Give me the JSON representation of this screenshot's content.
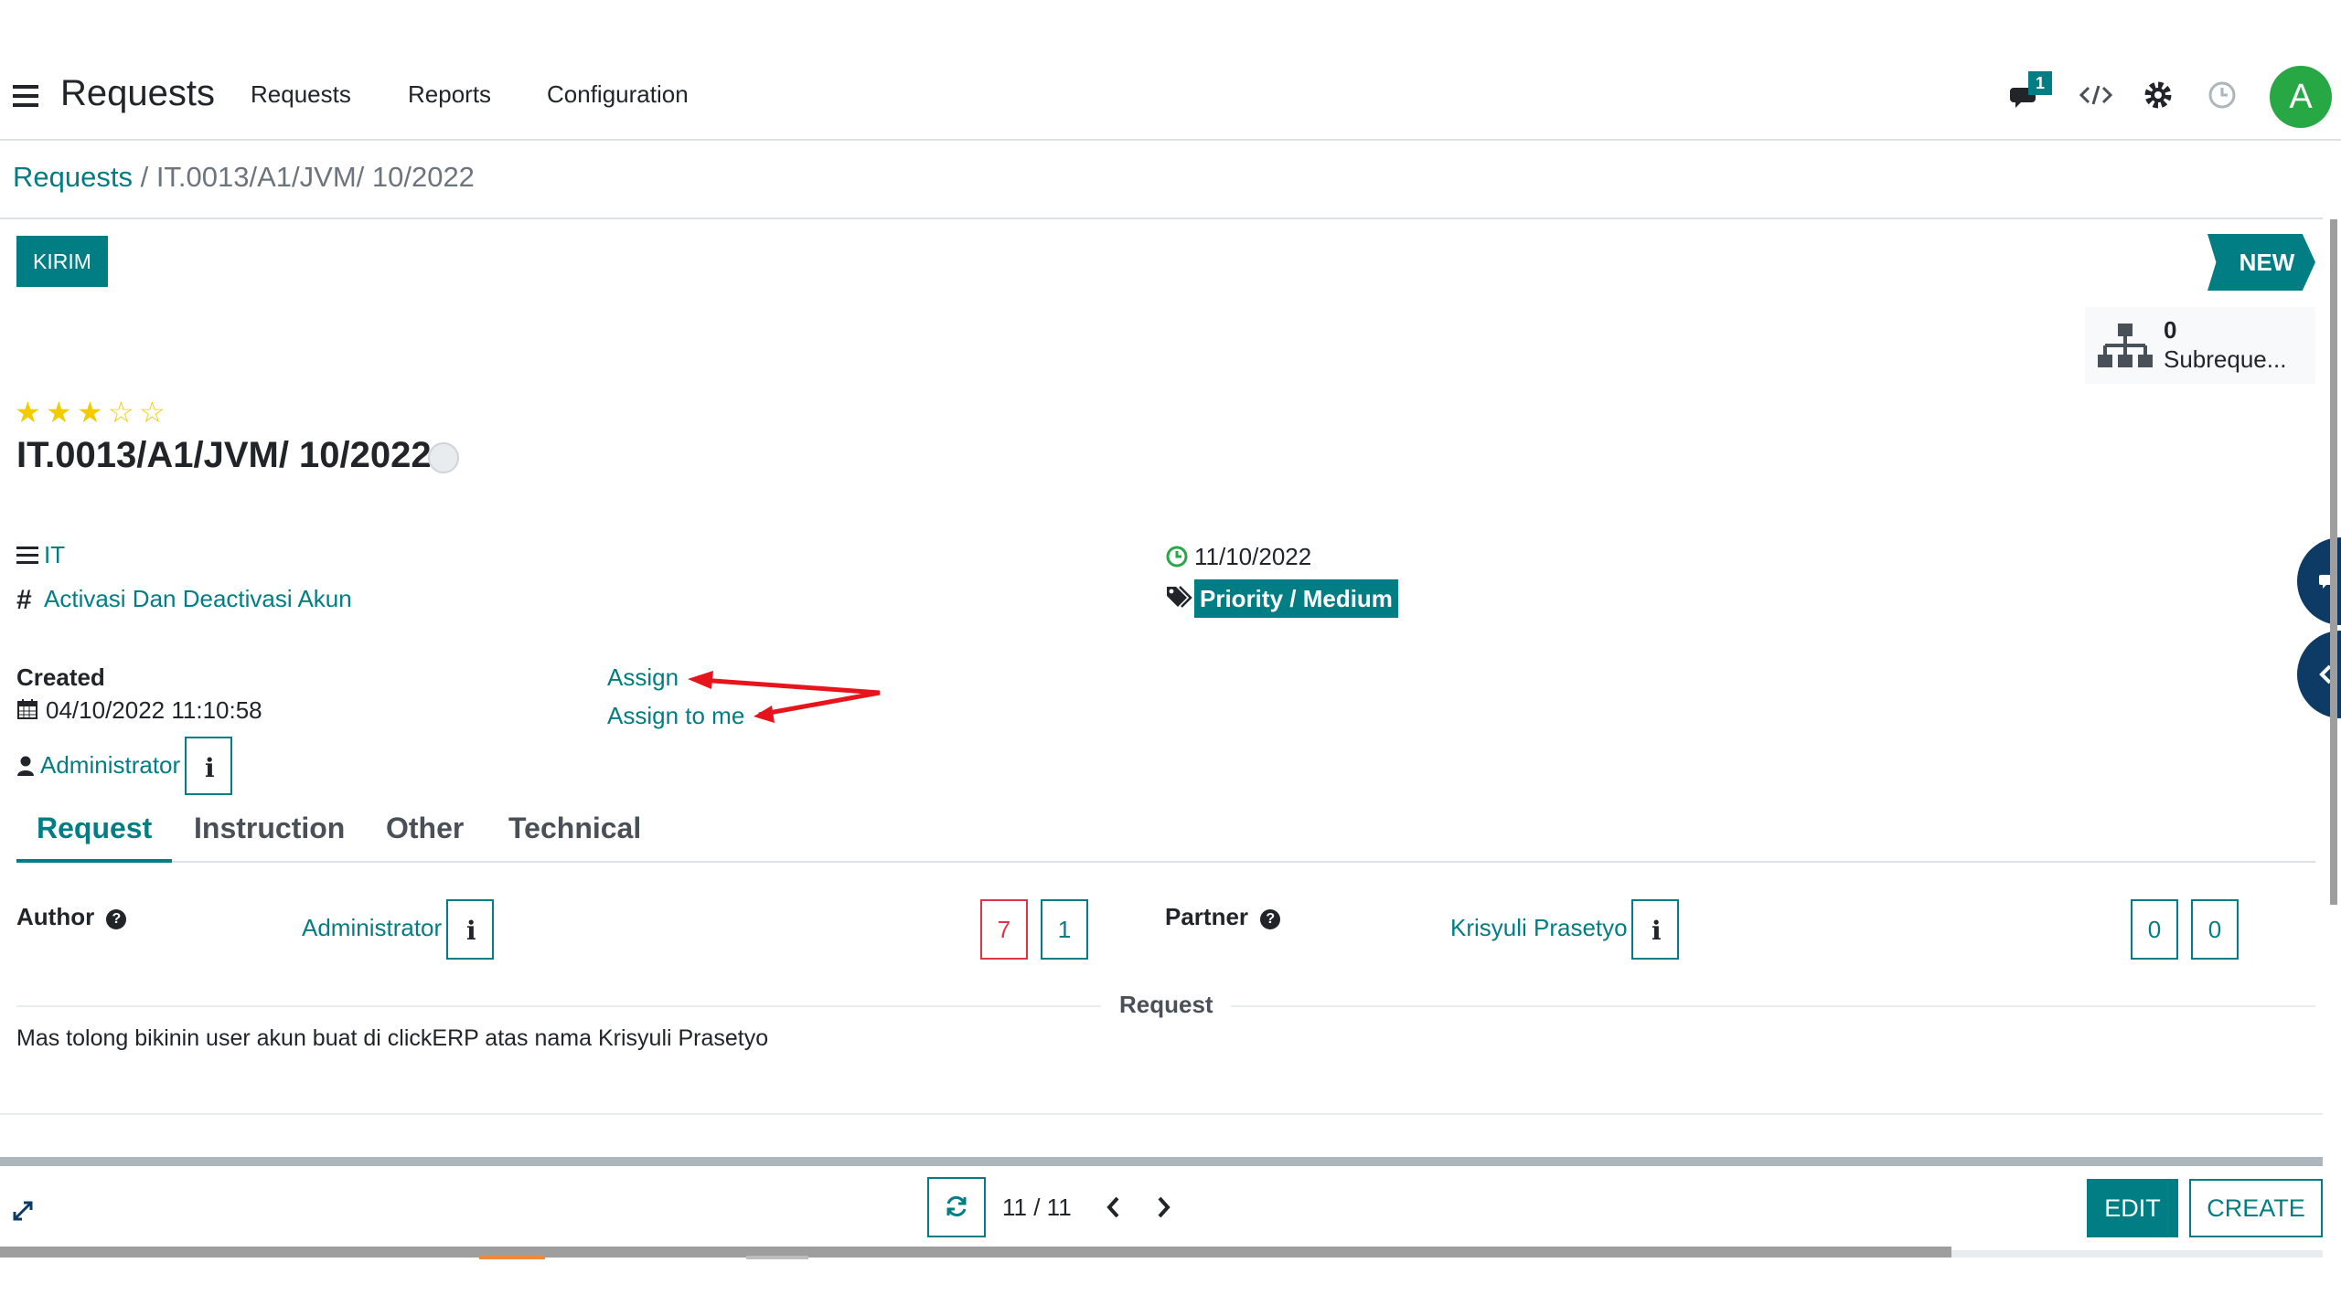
{
  "header": {
    "app_title": "Requests",
    "menu": [
      "Requests",
      "Reports",
      "Configuration"
    ],
    "messages_count": "1",
    "avatar_letter": "A",
    "avatar_color": "#28a745"
  },
  "breadcrumb": {
    "parent": "Requests",
    "separator": " / ",
    "current": "IT.0013/A1/JVM/ 10/2022"
  },
  "actions": {
    "kirim_label": "KIRIM",
    "stage_label": "NEW"
  },
  "subrequests": {
    "count": "0",
    "label": "Subreque..."
  },
  "record": {
    "rating": 3,
    "rating_max": 5,
    "title": "IT.0013/A1/JVM/ 10/2022",
    "category": "IT",
    "type": "Activasi Dan Deactivasi Akun",
    "date": "11/10/2022",
    "priority": "Priority / Medium",
    "created_label": "Created",
    "created_datetime": "04/10/2022 11:10:58",
    "created_by": "Administrator",
    "assign_label": "Assign",
    "assign_to_me_label": "Assign to me"
  },
  "tabs": [
    {
      "label": "Request",
      "active": true
    },
    {
      "label": "Instruction",
      "active": false
    },
    {
      "label": "Other",
      "active": false
    },
    {
      "label": "Technical",
      "active": false
    }
  ],
  "request_tab": {
    "author_label": "Author",
    "author_value": "Administrator",
    "author_counts": [
      "7",
      "1"
    ],
    "partner_label": "Partner",
    "partner_value": "Krisyuli Prasetyo",
    "partner_counts": [
      "0",
      "0"
    ],
    "section_title": "Request",
    "request_text": "Mas tolong bikinin user akun buat di clickERP atas nama Krisyuli Prasetyo"
  },
  "pager": {
    "text": "11 / 11"
  },
  "footer": {
    "edit_label": "EDIT",
    "create_label": "CREATE"
  },
  "colors": {
    "accent": "#017e84",
    "danger": "#dc3545",
    "star": "#f3cc00",
    "annotation_arrow": "#e8141b"
  }
}
